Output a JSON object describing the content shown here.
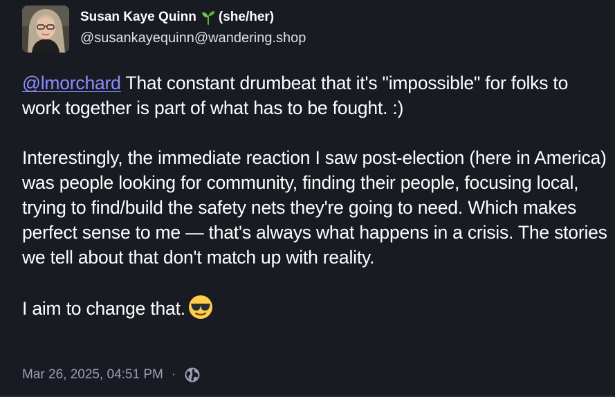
{
  "author": {
    "display_name": "Susan Kaye Quinn",
    "emoji_icon": "seedling-emoji",
    "pronouns": "(she/her)",
    "handle": "@susankayequinn@wandering.shop"
  },
  "post": {
    "mention": "@lmorchard",
    "paragraph_1_rest": " That constant drumbeat that it's \"impossible\" for folks to work together is part of what has to be fought. :)",
    "paragraph_2": "Interestingly, the immediate reaction I saw post-election (here in America) was people looking for community, finding their people, focusing local, trying to find/build the safety nets they're going to need. Which makes perfect sense to me — that's always what happens in a crisis. The stories we tell about that don't match up with reality.",
    "paragraph_3": "I aim to change that.",
    "closing_emoji": "smiling-face-with-sunglasses"
  },
  "meta": {
    "timestamp": "Mar 26, 2025, 04:51 PM",
    "separator": "·",
    "visibility_icon": "globe-icon"
  },
  "colors": {
    "background": "#191b22",
    "mention": "#8c8dff",
    "muted": "#9aa0b3"
  }
}
